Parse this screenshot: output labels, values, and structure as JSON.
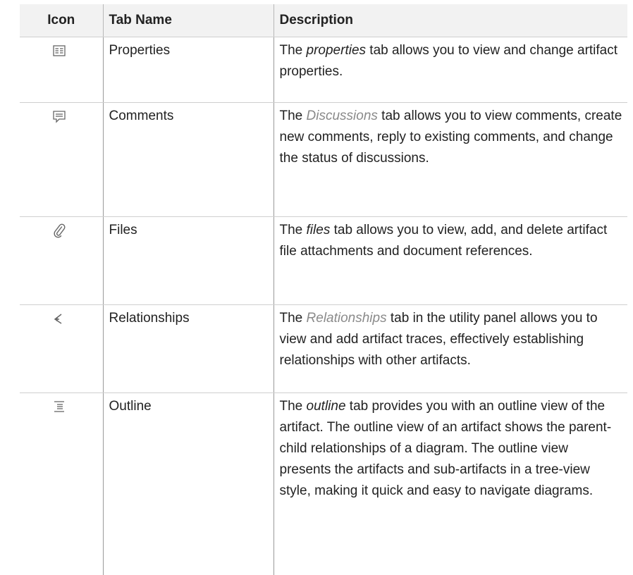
{
  "table": {
    "headers": {
      "icon": "Icon",
      "tab_name": "Tab Name",
      "description": "Description"
    },
    "rows": [
      {
        "icon": "properties-icon",
        "tab_name": "Properties",
        "desc_prefix": "The ",
        "desc_emphasis": "properties",
        "desc_suffix": " tab allows you to view and change artifact properties."
      },
      {
        "icon": "comments-icon",
        "tab_name": "Comments",
        "desc_prefix": "The ",
        "desc_emphasis": "Discussions",
        "desc_suffix": " tab allows you to view comments, create new comments, reply to existing comments, and change the status of discussions."
      },
      {
        "icon": "paperclip-icon",
        "tab_name": "Files",
        "desc_prefix": "The ",
        "desc_emphasis": "files",
        "desc_suffix": " tab allows you to view, add, and delete artifact file attachments and document references."
      },
      {
        "icon": "relationships-icon",
        "tab_name": "Relationships",
        "desc_prefix": "The ",
        "desc_emphasis": "Relationships",
        "desc_suffix": " tab in the utility panel allows you to view and add artifact traces, effectively establishing relationships with other artifacts."
      },
      {
        "icon": "outline-icon",
        "tab_name": "Outline",
        "desc_prefix": "The ",
        "desc_emphasis": "outline",
        "desc_suffix": " tab provides you with an outline view of the artifact. The outline view of an artifact shows the parent-child relationships of a diagram. The outline view presents the artifacts and sub-artifacts in a tree-view style, making it quick and easy to navigate diagrams."
      }
    ]
  }
}
